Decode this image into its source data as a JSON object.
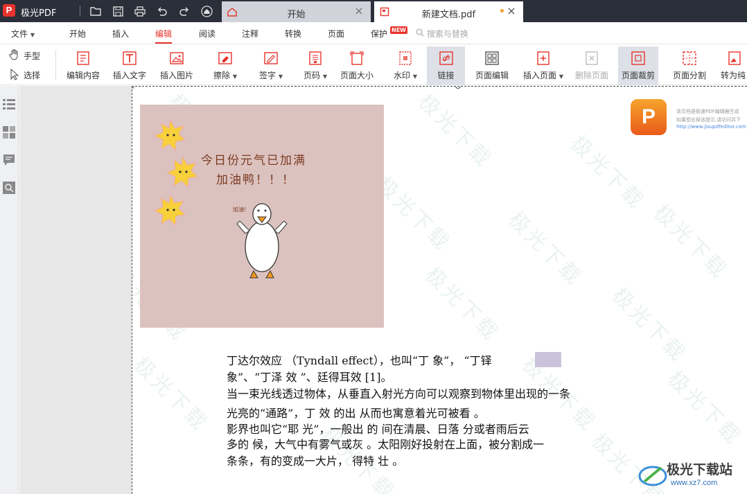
{
  "app": {
    "name": "极光PDF",
    "logo_letter": "P"
  },
  "tabs": [
    {
      "label": "开始",
      "icon": "home-icon"
    },
    {
      "label": "新建文档.pdf",
      "icon": "pdf-file-icon"
    }
  ],
  "menus": [
    "文件",
    "开始",
    "插入",
    "编辑",
    "阅读",
    "注释",
    "转换",
    "页面",
    "保护"
  ],
  "menu_active": "编辑",
  "new_badge": "NEW",
  "search_placeholder": "搜索与替换",
  "left_tools": {
    "hand": "手型",
    "select": "选择"
  },
  "tools": [
    {
      "label": "编辑内容"
    },
    {
      "label": "插入文字"
    },
    {
      "label": "插入图片"
    },
    {
      "label": "擦除"
    },
    {
      "label": "签字"
    },
    {
      "label": "页码"
    },
    {
      "label": "页面大小"
    },
    {
      "label": "水印"
    },
    {
      "label": "链接"
    },
    {
      "label": "页面编辑"
    },
    {
      "label": "插入页面"
    },
    {
      "label": "删除页面"
    },
    {
      "label": "页面裁剪"
    },
    {
      "label": "页面分割"
    },
    {
      "label": "转为纯"
    }
  ],
  "picture": {
    "line1": "今日份元气已加满",
    "line2": "加油鸭！！！",
    "small": "加油!"
  },
  "watermark": "极光下载",
  "doc_lines": [
    "丁达尔效应  （Tyndall effect），也叫“丁       象”，     “丁铎",
    "象”、“丁泽  效  ”、廷得耳效  [1]。",
    "当一束光线透过物体，从垂直入射光方向可以观察到物体里出现的一条",
    "光亮的“通路”，丁    效  的出  从而也寓意着光可被看  。",
    "  影界也叫它“耶  光”，一般出  的  间在清晨、日落  分或者雨后云",
    "  多的  候，大气中有雾气或灰  。太阳刚好投射在上面，被分割成一",
    "条条，有的变成一大片，   得特  壮  。"
  ],
  "corner_notes": [
    "该文档是极速PDF编辑器生成",
    "如果想去掉该提示,请访问并下",
    "http://www.jisupdfeditor.com"
  ],
  "brand": {
    "title": "极光下载站",
    "url": "www.xz7.com"
  }
}
